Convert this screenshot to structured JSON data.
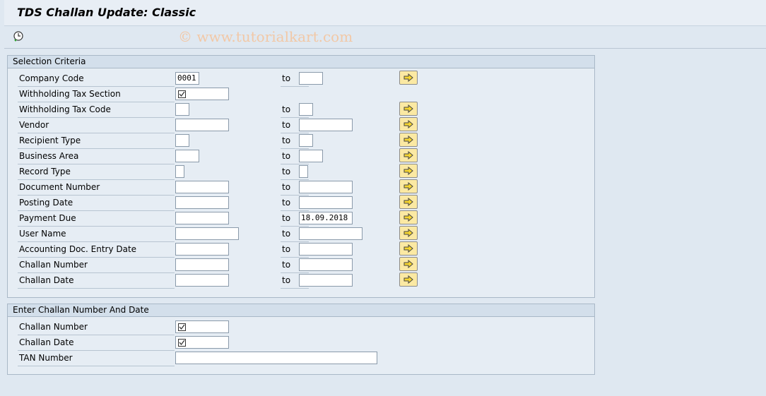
{
  "window": {
    "title": "TDS Challan Update:  Classic"
  },
  "toolbar": {
    "execute_icon": "execute-clock-icon"
  },
  "watermark": "© www.tutorialkart.com",
  "selection": {
    "title": "Selection Criteria",
    "to_label": "to",
    "rows": [
      {
        "label": "Company Code",
        "from": "0001",
        "to": ""
      },
      {
        "label": "Withholding Tax Section",
        "from": "",
        "checked": true
      },
      {
        "label": "Withholding Tax Code",
        "from": "",
        "to": ""
      },
      {
        "label": "Vendor",
        "from": "",
        "to": ""
      },
      {
        "label": "Recipient Type",
        "from": "",
        "to": ""
      },
      {
        "label": "Business Area",
        "from": "",
        "to": ""
      },
      {
        "label": "Record Type",
        "from": "",
        "to": ""
      },
      {
        "label": "Document Number",
        "from": "",
        "to": ""
      },
      {
        "label": "Posting Date",
        "from": "",
        "to": ""
      },
      {
        "label": "Payment Due",
        "from": "",
        "to": "18.09.2018"
      },
      {
        "label": "User Name",
        "from": "",
        "to": ""
      },
      {
        "label": "Accounting Doc. Entry Date",
        "from": "",
        "to": ""
      },
      {
        "label": "Challan Number",
        "from": "",
        "to": ""
      },
      {
        "label": "Challan Date",
        "from": "",
        "to": ""
      }
    ]
  },
  "challan": {
    "title": "Enter Challan Number And Date",
    "rows": [
      {
        "label": "Challan Number",
        "checked": true
      },
      {
        "label": "Challan Date",
        "checked": true
      },
      {
        "label": "TAN Number",
        "value": ""
      }
    ]
  },
  "colors": {
    "background": "#dfe8f1",
    "group_header": "#d3dfeb",
    "button": "#fbe9a3"
  }
}
